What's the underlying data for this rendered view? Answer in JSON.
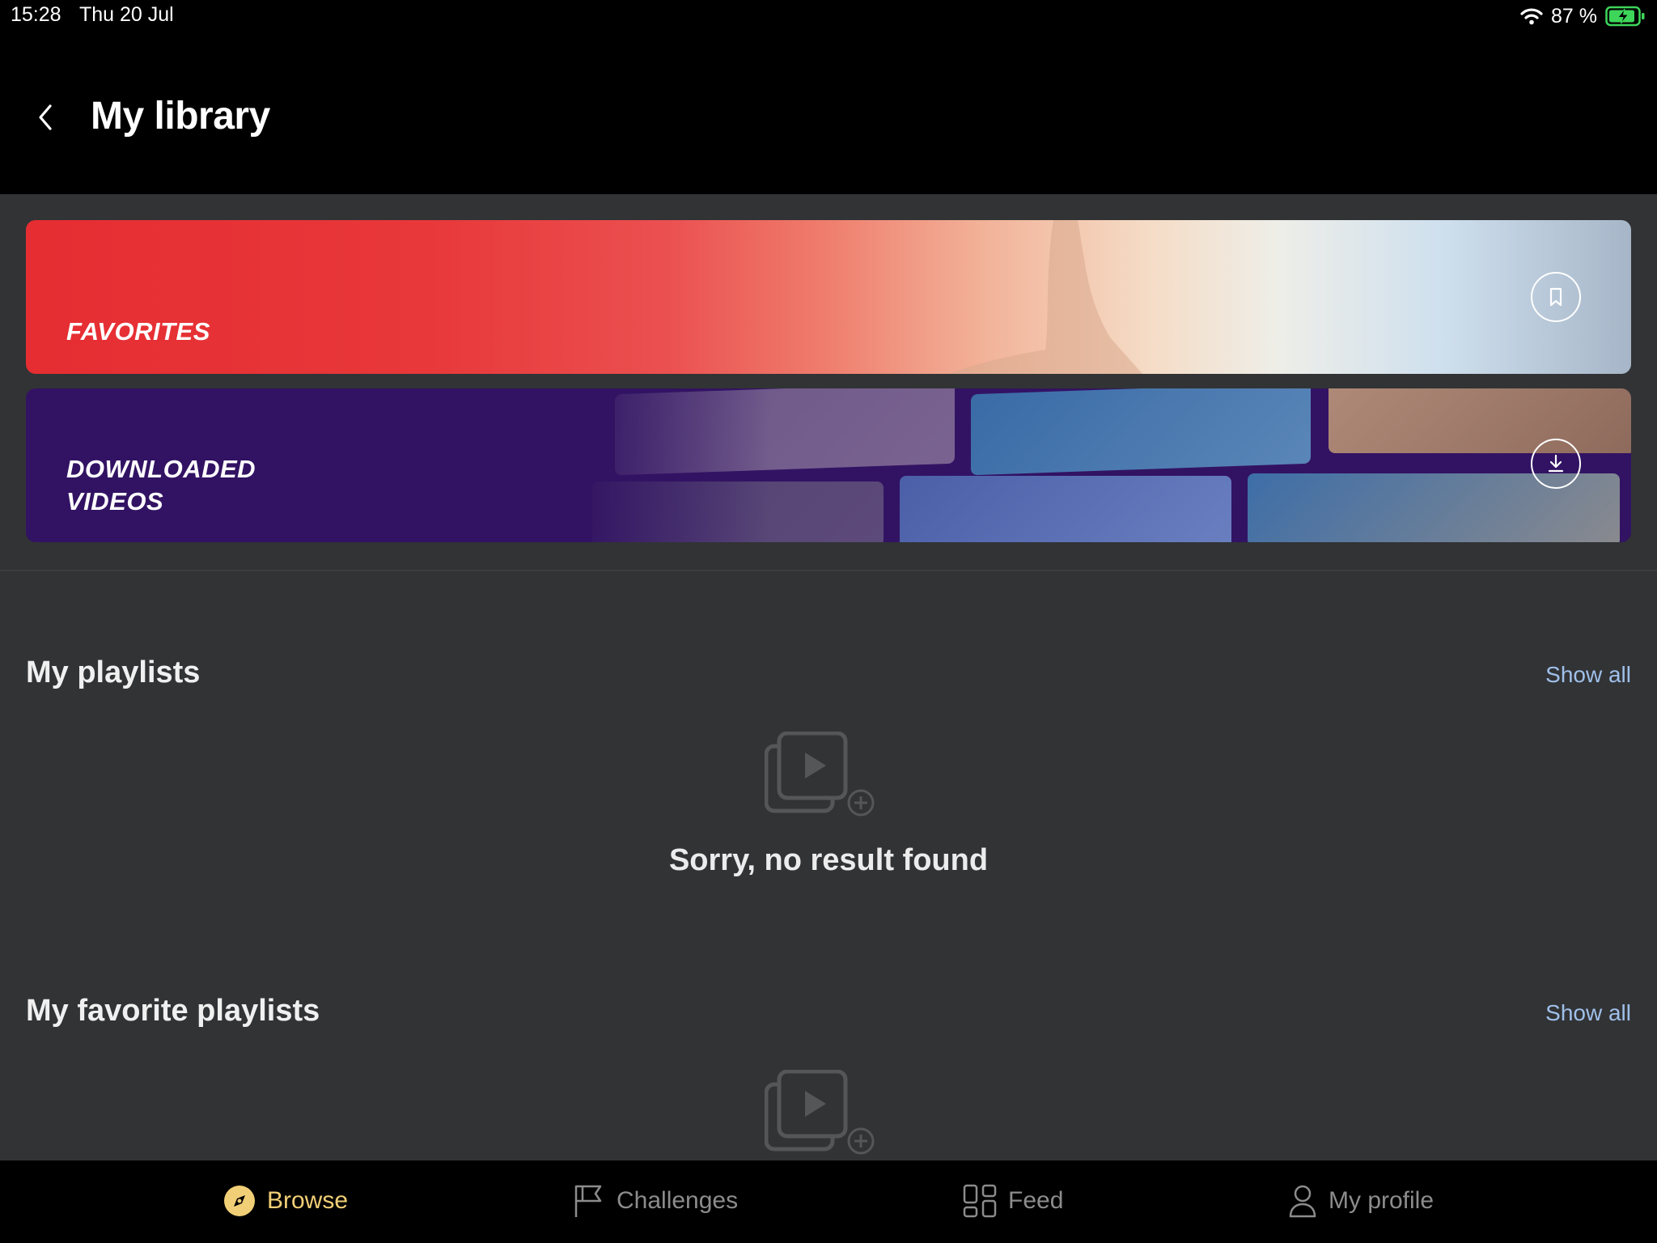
{
  "status_bar": {
    "time": "15:28",
    "date": "Thu 20 Jul",
    "battery": "87 %",
    "icons": [
      "wifi-icon",
      "battery-charging-icon"
    ]
  },
  "header": {
    "title": "My library",
    "back_icon": "chevron-left-icon"
  },
  "banners": {
    "favorites": {
      "label": "FAVORITES",
      "icon": "bookmark-icon",
      "accent": "#e52d32"
    },
    "downloaded": {
      "label_line1": "DOWNLOADED",
      "label_line2": "VIDEOS",
      "icon": "download-icon",
      "accent": "#321363"
    }
  },
  "sections": {
    "my_playlists": {
      "title": "My playlists",
      "show_all": "Show all",
      "empty_text": "Sorry, no result found",
      "empty_icon": "playlist-add-icon"
    },
    "favorite_playlists": {
      "title": "My favorite playlists",
      "show_all": "Show all",
      "empty_icon": "playlist-add-icon"
    }
  },
  "tabbar": {
    "active_color": "#f1cf76",
    "items": [
      {
        "label": "Browse",
        "icon": "compass-icon",
        "active": true
      },
      {
        "label": "Challenges",
        "icon": "flag-icon",
        "active": false
      },
      {
        "label": "Feed",
        "icon": "grid-icon",
        "active": false
      },
      {
        "label": "My profile",
        "icon": "user-icon",
        "active": false
      }
    ]
  }
}
